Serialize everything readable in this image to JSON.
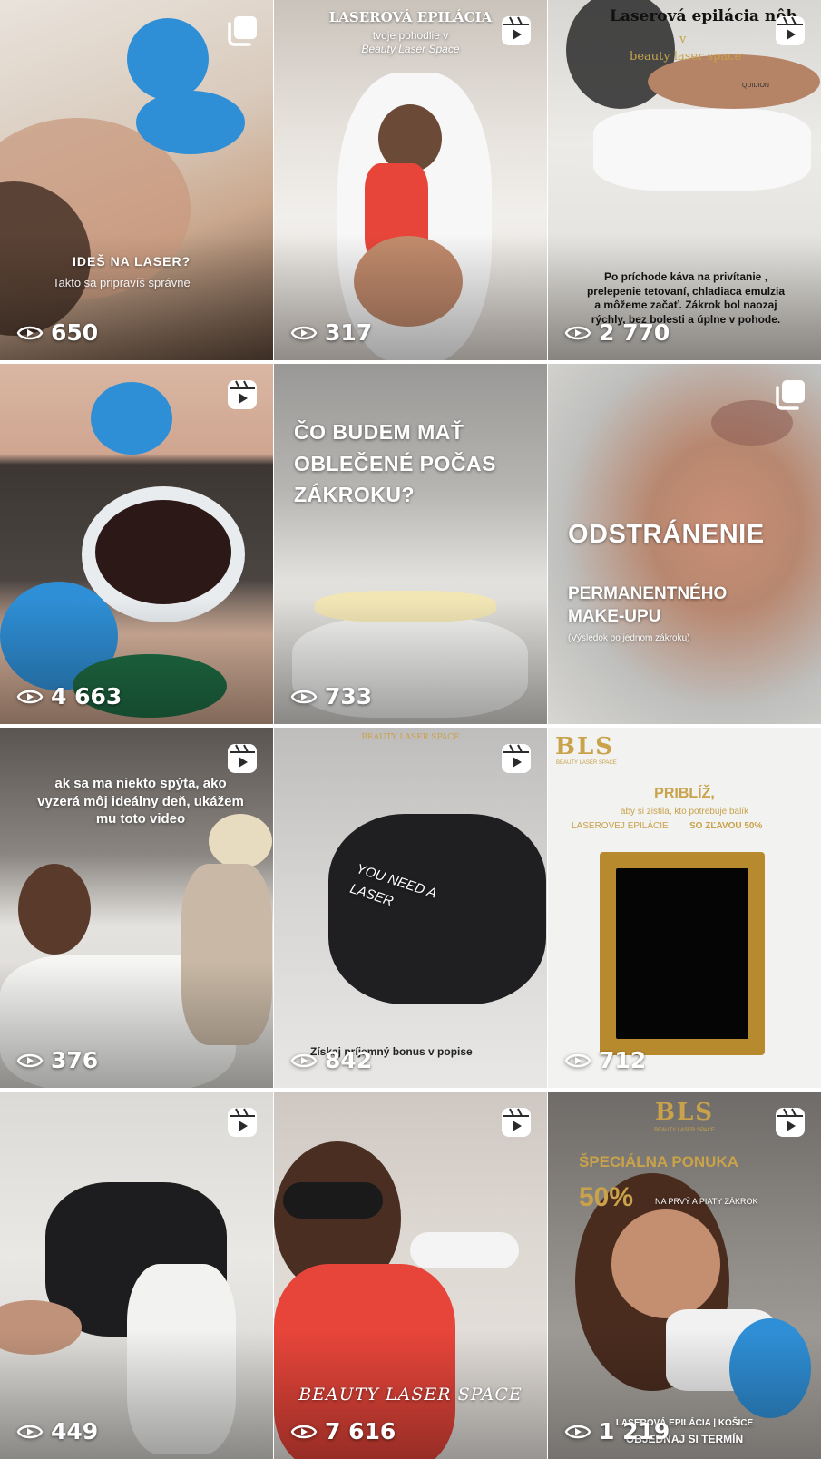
{
  "colors": {
    "glove_blue": "#2f8fd6",
    "gold": "#c9a24a",
    "red_swimsuit": "#e8453a",
    "wax_green": "#1f6e45"
  },
  "icons": {
    "reel": "reel-icon",
    "carousel": "carousel-icon",
    "views": "eye-play-icon"
  },
  "posts": [
    {
      "type": "carousel",
      "views": "650",
      "text": [
        "IDEŠ NA LASER?",
        "Takto sa pripravíš správne"
      ]
    },
    {
      "type": "reel",
      "views": "317",
      "text": [
        "LASEROVÁ EPILÁCIA",
        "tvoje pohodlie v",
        "Beauty Laser Space"
      ]
    },
    {
      "type": "reel",
      "views": "2 770",
      "text": [
        "Laserová epilácia nôh",
        "v",
        "beauty laser space",
        "QUIDION",
        "Po príchode káva na privítanie , prelepenie tetovaní, chladiaca emulzia a môžeme začať. Zákrok bol naozaj rýchly, bez bolesti a úplne v pohode."
      ]
    },
    {
      "type": "reel",
      "views": "4 663",
      "text": []
    },
    {
      "type": "none",
      "views": "733",
      "text": [
        "ČO BUDEM MAŤ OBLEČENÉ POČAS ZÁKROKU?"
      ]
    },
    {
      "type": "carousel",
      "views": "",
      "text": [
        "ODSTRÁNENIE",
        "PERMANENTNÉHO MAKE-UPU",
        "(Výsledok po jednom zákroku)"
      ]
    },
    {
      "type": "reel",
      "views": "376",
      "text": [
        "ak sa ma niekto spýta, ako vyzerá môj ideálny deň, ukážem mu toto video"
      ]
    },
    {
      "type": "reel",
      "views": "842",
      "text": [
        "BEAUTY LASER SPACE",
        "YOU NEED A LASER",
        "Získaj príjemný bonus v popise"
      ]
    },
    {
      "type": "none",
      "views": "712",
      "text": [
        "BLS",
        "BEAUTY LASER SPACE",
        "PRIBLÍŽ,",
        "aby si zistila, kto potrebuje balík",
        "LASEROVEJ EPILÁCIE",
        "SO ZĽAVOU 50%"
      ]
    },
    {
      "type": "reel",
      "views": "449",
      "text": []
    },
    {
      "type": "reel",
      "views": "7 616",
      "text": [
        "BEAUTY LASER SPACE"
      ]
    },
    {
      "type": "reel",
      "views": "1 219",
      "text": [
        "BLS",
        "BEAUTY LASER SPACE",
        "ŠPECIÁLNA PONUKA",
        "50%",
        "NA PRVÝ A PIATY ZÁKROK",
        "LASEROVÁ EPILÁCIA | KOŠICE",
        "OBJEDNAJ SI TERMÍN"
      ]
    }
  ]
}
